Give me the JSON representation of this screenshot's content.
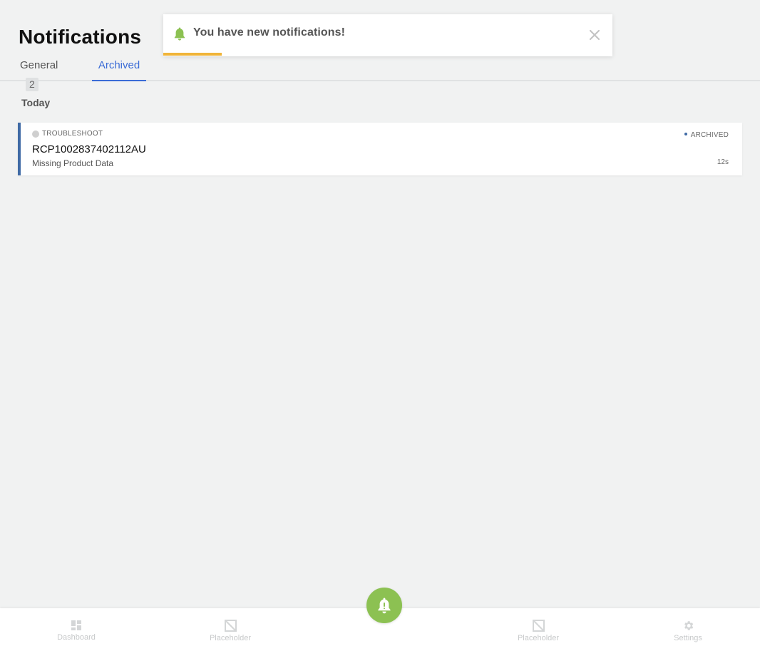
{
  "header": {
    "title": "Notifications",
    "tabs": [
      {
        "label": "General",
        "badge": "2"
      },
      {
        "label": "Archived"
      }
    ]
  },
  "toast": {
    "message": "You have new notifications!",
    "progress": 0.13,
    "icon": "bell-icon",
    "close_icon": "close-icon"
  },
  "main": {
    "section": "Today",
    "notifications": [
      {
        "category": "TROUBLESHOOT",
        "reference": "RCP1002837402112AU",
        "description": "Missing Product Data",
        "status": "ARCHIVED",
        "time": "12s"
      }
    ]
  },
  "nav": {
    "items": [
      {
        "label": "Dashboard",
        "icon": "dashboard-icon"
      },
      {
        "label": "Placeholder",
        "icon": "placeholder-icon"
      },
      {
        "label": "Placeholder",
        "icon": "placeholder-icon"
      },
      {
        "label": "Settings",
        "icon": "gear-icon"
      }
    ],
    "fab_icon": "bell-alert-icon"
  },
  "colors": {
    "accent": "#3b6cd6",
    "card_border": "#3f6aa5",
    "toast_progress": "#f0b43a",
    "fab": "#8cc152",
    "background": "#f1f2f2"
  }
}
